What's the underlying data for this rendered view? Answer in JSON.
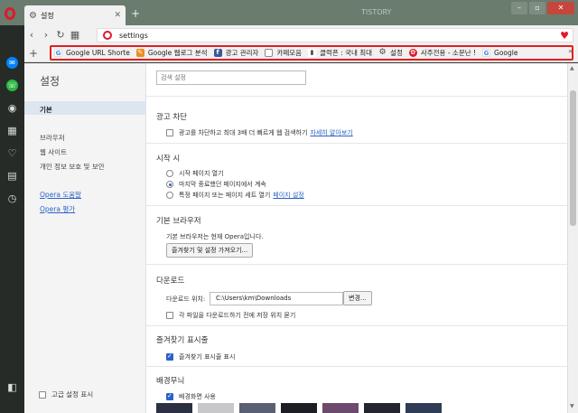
{
  "tab": {
    "title": "설정"
  },
  "window": {
    "bg_text": "TISTORY"
  },
  "address": {
    "url": "settings"
  },
  "bookmarks": [
    {
      "label": "Google URL Shorte",
      "icon": "google-icon"
    },
    {
      "label": "Google 웹로그 분석",
      "icon": "blog-icon"
    },
    {
      "label": "광고 관리자",
      "icon": "facebook-icon"
    },
    {
      "label": "카페모음",
      "icon": "folder-icon"
    },
    {
      "label": "클럭픈 : 국내 최대",
      "icon": "document-icon"
    },
    {
      "label": "설정",
      "icon": "gear-icon"
    },
    {
      "label": "사주전용 - 소문난 !",
      "icon": "saju-icon"
    },
    {
      "label": "Google",
      "icon": "google-icon"
    }
  ],
  "nav": {
    "title": "설정",
    "basic": "기본",
    "browser": "브라우저",
    "websites": "웹 사이트",
    "privacy": "개인 정보 보호 및 보안",
    "help": "Opera 도움말",
    "rate": "Opera 평가",
    "advanced": "고급 설정 표시"
  },
  "search": {
    "placeholder": "검색 설정"
  },
  "ad_block": {
    "title": "광고 차단",
    "option": "광고를 차단하고 최대 3배 더 빠르게 웹 검색하기",
    "learn_more": "자세히 알아보기"
  },
  "startup": {
    "title": "시작 시",
    "opt1": "시작 페이지 열기",
    "opt2": "마지막 종료했던 페이지에서 계속",
    "opt3": "특정 페이지 또는 페이지 세트 열기",
    "set_pages": "페이지 설정"
  },
  "default_browser": {
    "title": "기본 브라우저",
    "status": "기본 브라우저는 현재 Opera입니다.",
    "import_button": "즐겨찾기 및 설정 가져오기..."
  },
  "downloads": {
    "title": "다운로드",
    "location_label": "다운로드 위치:",
    "path": "C:\\Users\\km\\Downloads",
    "change_button": "변경...",
    "ask_option": "각 파일을 다운로드하기 전에 저장 위치 묻기"
  },
  "bookmarks_bar": {
    "title": "즐겨찾기 표시줄",
    "show_option": "즐겨찾기 표시줄 표시"
  },
  "wallpaper": {
    "title": "배경무늬",
    "use_option": "배경화면 사용"
  },
  "colors": {
    "accent": "#2b63c6",
    "opera_red": "#e0192a",
    "highlight_border": "#e41e1e"
  }
}
